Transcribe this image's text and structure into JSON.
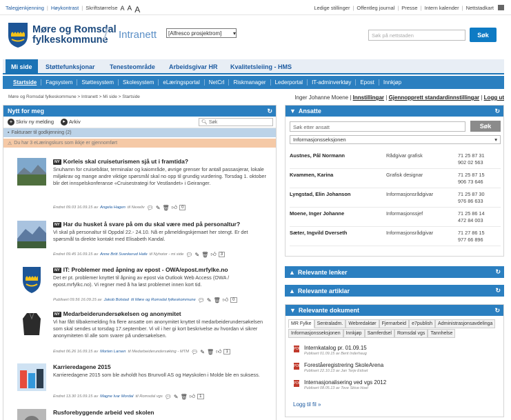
{
  "util": {
    "left": [
      "Talegjenkjenning",
      "Høykontrast",
      "Skriftstørrelse"
    ],
    "font_sizes": [
      "A",
      "A",
      "A"
    ],
    "right": [
      "Ledige stillinger",
      "Offentleg journal",
      "Presse",
      "Intern kalender",
      "Nettstadkart"
    ]
  },
  "header": {
    "org_line1": "Møre og Romsdal",
    "org_line2": "fylkeskommune",
    "site": "Intranett",
    "site_select": "[Alfresco prosjektrom]",
    "search_placeholder": "Søk på nettstaden",
    "search_button": "Søk"
  },
  "mainnav": [
    "Mi side",
    "Støttefunksjonar",
    "Tenesteområde",
    "Arbeidsgivar HR",
    "Kvalitetsleiing - HMS"
  ],
  "subnav": [
    "Startside",
    "Fagsystem",
    "Støttesystem",
    "Skolesystem",
    "eLæringsportal",
    "NetCrl",
    "Riskmanager",
    "Lederportal",
    "IT-adminverktøy",
    "Epost",
    "Innkjøp"
  ],
  "breadcrumb": "Møre og Romsdal fylkeskommune  >  Intranett  >  Mi side  >  Startside",
  "userbar": {
    "name": "Inger Johanne Moene",
    "sep": "|",
    "link1": "Innstillingar",
    "link2": "Gjennopprett standardinnstillingar",
    "link3": "Logg ut"
  },
  "nytt": {
    "title": "Nytt for meg",
    "write": "Skriv ny melding",
    "archive": "Arkiv",
    "search_placeholder": "Søk",
    "notice1": "Fakturaer til godkjenning (2)",
    "notice2": "Du har 3 eLæringskurs som ikkje er gjennomført",
    "badge": "NY",
    "items": [
      {
        "title": "Korleis skal cruiseturismen sjå ut i framtida?",
        "body": "Snuhamn for cruisebåtar, terminalar og kaiområde, øvrige grenser for antall passasjerar, lokale miljøkrav og mange andre viktige spørsmål skal no opp til grundig vurdering. Torsdag 1. oktober blir det innspelskonferanse «Cruisestrategi for Vestlandet» i Geiranger.",
        "meta": "Endret 09.03 16.09.15 av",
        "author": "Angela Hagen",
        "tail": "til Nexeliv",
        "count": "0"
      },
      {
        "title": "Har du husket å svare på om du skal være med på personaltur?",
        "body": "Vi skal på personaltur til Oppdal 22.- 24.10. Nå er påmeldingskjemaet her stengt. Er det spørsmål ta direkte kontakt med Elisabeth Kandal.",
        "meta": "Endret 09.45 16.09.15 av",
        "author": "Anne Britt Svenkerud Hafe",
        "tail": "til Nyhotor - mi side",
        "count": "3"
      },
      {
        "title": "IT: Problemer med åpning av epost - OWA/epost.mrfylke.no",
        "body": "Det er pt. problemer knyttet til åpning av epost via Outlook Web Access (OWA / epost.mrfylkc.no). Vi regner med å ha løst problemet innen kort tid.",
        "meta": "Publisert 09.56 16.09.15 av",
        "author": "Jakob Bolstad",
        "tail": "til Møre og Romsdal fylkeskommune",
        "count": "0"
      },
      {
        "title": "Medarbeiderundersøkelsen og anonymitet",
        "body": "Vi har fått tilbakemelding fra flere ansatte om anonymitet knyttet til medarbeiderundersøkelsen som skal sendes ut torsdag 17.september. Vi vil i her gi kort beskrivelse av hvordan vi sikrer anonymiteten til alle som svarer på undersøkelsen.",
        "meta": "Endret 06.26 16.09.15 av",
        "author": "Morten Larsen",
        "tail": "til Medarbeiderundersøking - MTM",
        "count": "1"
      },
      {
        "title": "Karrieredagene 2015",
        "body": "Karrieredagene 2015 som ble avholdt hos Brunvoll AS og Høyskolen i Molde ble en suksess.",
        "meta": "Endret 13.30 15.09.15 av",
        "author": "Magne Ivar Mordal",
        "tail": "til Romsdal vgs",
        "count": "1"
      },
      {
        "title": "Rusforebyggende arbeid ved skolen",
        "body": "",
        "meta": "",
        "author": "",
        "tail": "",
        "count": ""
      }
    ]
  },
  "ansatte": {
    "title": "Ansatte",
    "search_placeholder": "Søk etter ansatt",
    "button": "Søk",
    "select": "Informasjonsseksjonen",
    "rows": [
      {
        "name": "Austnes, Pål Normann",
        "title": "Rådgivar grafisk",
        "p1": "71 25 87 31",
        "p2": "902 02 563"
      },
      {
        "name": "Kvammen, Karina",
        "title": "Grafisk designar",
        "p1": "71 25 87 15",
        "p2": "906 73 646"
      },
      {
        "name": "Lyngstad, Elin Johanson",
        "title": "Informasjonsrådgivar",
        "p1": "71 25 87 30",
        "p2": "976 86 633"
      },
      {
        "name": "Moene, Inger Johanne",
        "title": "Informasjonssjef",
        "p1": "71 25 86 14",
        "p2": "472 84 003"
      },
      {
        "name": "Sæter, Ingvild Dverseth",
        "title": "Informasjonsrådgivar",
        "p1": "71 27 86 15",
        "p2": "977 66 896"
      }
    ]
  },
  "lenker": {
    "title": "Relevante lenker"
  },
  "artiklar": {
    "title": "Relevante artiklar"
  },
  "dokument": {
    "title": "Relevante dokument",
    "tabs": [
      "MR Fylke",
      "Sentraladm.",
      "Webredaktør",
      "Fjernarbeid",
      "e7publish",
      "Administrasjonsavdelinga",
      "Informasjonsseksjonen",
      "Innkjøp",
      "Samferdsel",
      "Romsdal vgs",
      "Tannhelse"
    ],
    "docs": [
      {
        "title": "Internkatalog pr. 01.09.15",
        "meta": "Publisert 01.09.15 av Berit Inderhaug"
      },
      {
        "title": "Foreståeregistrering SkoleArena",
        "meta": "Publisert 22.10.13 av Jan Terje Eidset"
      },
      {
        "title": "Internasjonalisering ved vgs 2012",
        "meta": "Publisert 08.05.13 av Tove Skive Hoel"
      }
    ],
    "more": "Logg til fil »"
  }
}
